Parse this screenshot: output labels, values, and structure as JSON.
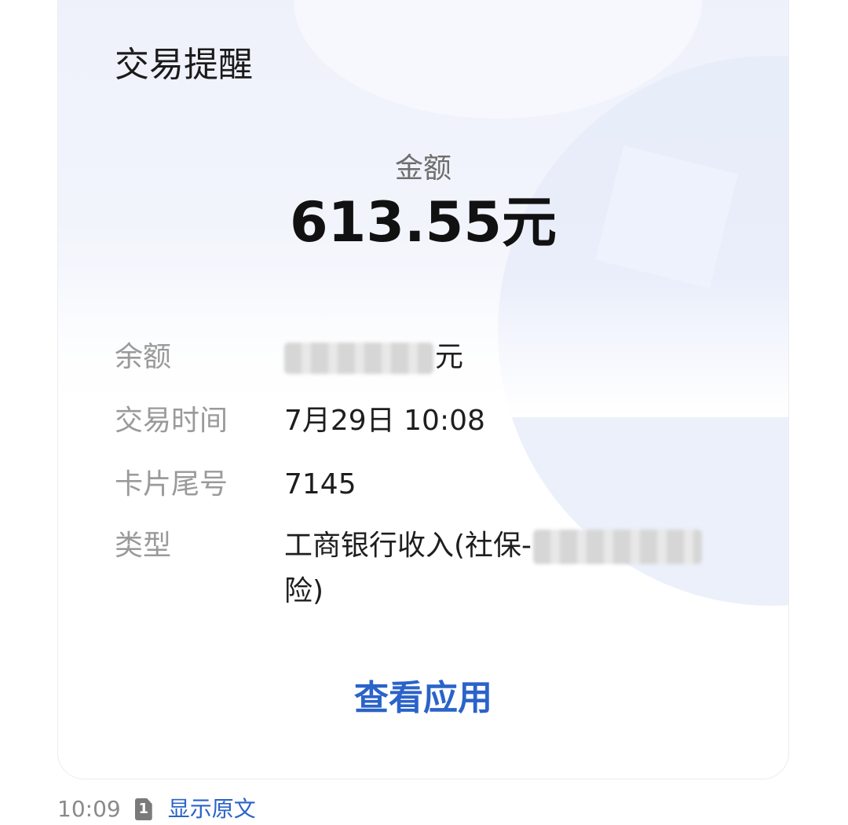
{
  "card": {
    "title": "交易提醒",
    "amount_label": "金额",
    "amount_value": "613.55元",
    "rows": [
      {
        "label": "余额",
        "value_suffix": "元"
      },
      {
        "label": "交易时间",
        "value": "7月29日 10:08"
      },
      {
        "label": "卡片尾号",
        "value": "7145"
      },
      {
        "label": "类型",
        "value_prefix": "工商银行收入(社保-",
        "value_line2": "险)"
      }
    ],
    "action_label": "查看应用"
  },
  "footer": {
    "time": "10:09",
    "sim_number": "1",
    "show_original": "显示原文"
  },
  "colors": {
    "accent": "#2a63c9",
    "label": "#9a9a9a",
    "text": "#1e1e1e"
  },
  "icons": {
    "sim": "sim-card-icon"
  }
}
